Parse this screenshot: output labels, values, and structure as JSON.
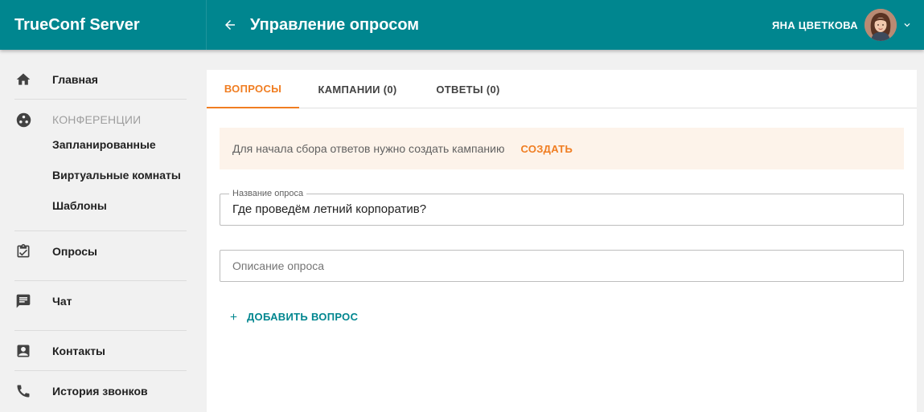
{
  "app": {
    "brand": "TrueConf Server"
  },
  "header": {
    "back_icon": "arrow-left-icon",
    "title": "Управление опросом",
    "user_name": "ЯНА ЦВЕТКОВА",
    "dropdown_icon": "chevron-down-icon"
  },
  "sidebar": {
    "home": {
      "label": "Главная",
      "icon": "home-icon"
    },
    "conferences": {
      "label": "КОНФЕРЕНЦИИ",
      "icon": "conferences-icon",
      "items": [
        "Запланированные",
        "Виртуальные комнаты",
        "Шаблоны"
      ]
    },
    "polls": {
      "label": "Опросы",
      "icon": "clipboard-check-icon"
    },
    "chat": {
      "label": "Чат",
      "icon": "chat-icon"
    },
    "contacts": {
      "label": "Контакты",
      "icon": "contact-card-icon"
    },
    "history": {
      "label": "История звонков",
      "icon": "phone-icon"
    }
  },
  "tabs": [
    {
      "label": "ВОПРОСЫ",
      "active": true
    },
    {
      "label": "КАМПАНИИ (0)",
      "active": false
    },
    {
      "label": "ОТВЕТЫ (0)",
      "active": false
    }
  ],
  "notice": {
    "text": "Для начала сбора ответов нужно создать кампанию",
    "action": "СОЗДАТЬ"
  },
  "form": {
    "name_label": "Название опроса",
    "name_value": "Где проведём летний корпоратив?",
    "description_placeholder": "Описание опроса"
  },
  "add_question": {
    "label": "ДОБАВИТЬ ВОПРОС",
    "icon": "plus-icon"
  },
  "colors": {
    "primary": "#00868f",
    "accent": "#f07d21",
    "notice_bg": "#fdf3ea"
  }
}
